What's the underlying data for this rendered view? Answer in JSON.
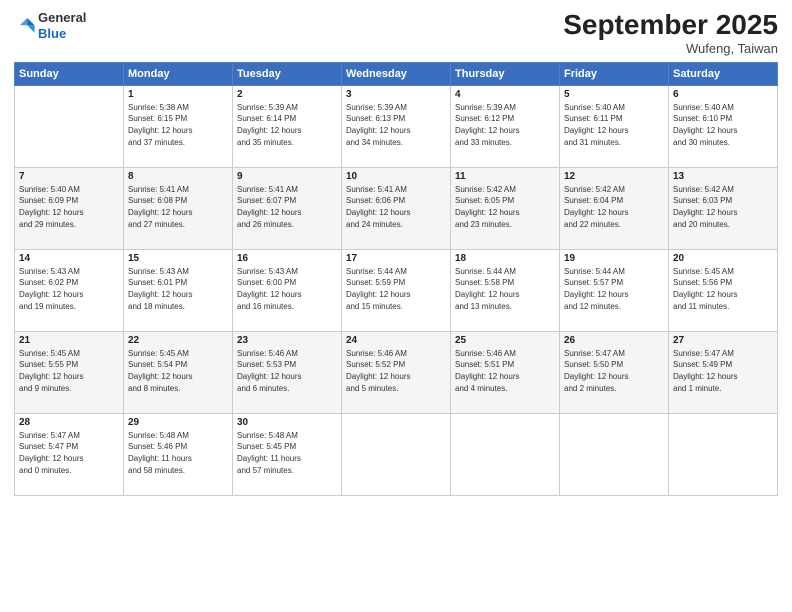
{
  "logo": {
    "general": "General",
    "blue": "Blue"
  },
  "title": "September 2025",
  "subtitle": "Wufeng, Taiwan",
  "days_header": [
    "Sunday",
    "Monday",
    "Tuesday",
    "Wednesday",
    "Thursday",
    "Friday",
    "Saturday"
  ],
  "weeks": [
    [
      {
        "num": "",
        "info": ""
      },
      {
        "num": "1",
        "info": "Sunrise: 5:38 AM\nSunset: 6:15 PM\nDaylight: 12 hours\nand 37 minutes."
      },
      {
        "num": "2",
        "info": "Sunrise: 5:39 AM\nSunset: 6:14 PM\nDaylight: 12 hours\nand 35 minutes."
      },
      {
        "num": "3",
        "info": "Sunrise: 5:39 AM\nSunset: 6:13 PM\nDaylight: 12 hours\nand 34 minutes."
      },
      {
        "num": "4",
        "info": "Sunrise: 5:39 AM\nSunset: 6:12 PM\nDaylight: 12 hours\nand 33 minutes."
      },
      {
        "num": "5",
        "info": "Sunrise: 5:40 AM\nSunset: 6:11 PM\nDaylight: 12 hours\nand 31 minutes."
      },
      {
        "num": "6",
        "info": "Sunrise: 5:40 AM\nSunset: 6:10 PM\nDaylight: 12 hours\nand 30 minutes."
      }
    ],
    [
      {
        "num": "7",
        "info": "Sunrise: 5:40 AM\nSunset: 6:09 PM\nDaylight: 12 hours\nand 29 minutes."
      },
      {
        "num": "8",
        "info": "Sunrise: 5:41 AM\nSunset: 6:08 PM\nDaylight: 12 hours\nand 27 minutes."
      },
      {
        "num": "9",
        "info": "Sunrise: 5:41 AM\nSunset: 6:07 PM\nDaylight: 12 hours\nand 26 minutes."
      },
      {
        "num": "10",
        "info": "Sunrise: 5:41 AM\nSunset: 6:06 PM\nDaylight: 12 hours\nand 24 minutes."
      },
      {
        "num": "11",
        "info": "Sunrise: 5:42 AM\nSunset: 6:05 PM\nDaylight: 12 hours\nand 23 minutes."
      },
      {
        "num": "12",
        "info": "Sunrise: 5:42 AM\nSunset: 6:04 PM\nDaylight: 12 hours\nand 22 minutes."
      },
      {
        "num": "13",
        "info": "Sunrise: 5:42 AM\nSunset: 6:03 PM\nDaylight: 12 hours\nand 20 minutes."
      }
    ],
    [
      {
        "num": "14",
        "info": "Sunrise: 5:43 AM\nSunset: 6:02 PM\nDaylight: 12 hours\nand 19 minutes."
      },
      {
        "num": "15",
        "info": "Sunrise: 5:43 AM\nSunset: 6:01 PM\nDaylight: 12 hours\nand 18 minutes."
      },
      {
        "num": "16",
        "info": "Sunrise: 5:43 AM\nSunset: 6:00 PM\nDaylight: 12 hours\nand 16 minutes."
      },
      {
        "num": "17",
        "info": "Sunrise: 5:44 AM\nSunset: 5:59 PM\nDaylight: 12 hours\nand 15 minutes."
      },
      {
        "num": "18",
        "info": "Sunrise: 5:44 AM\nSunset: 5:58 PM\nDaylight: 12 hours\nand 13 minutes."
      },
      {
        "num": "19",
        "info": "Sunrise: 5:44 AM\nSunset: 5:57 PM\nDaylight: 12 hours\nand 12 minutes."
      },
      {
        "num": "20",
        "info": "Sunrise: 5:45 AM\nSunset: 5:56 PM\nDaylight: 12 hours\nand 11 minutes."
      }
    ],
    [
      {
        "num": "21",
        "info": "Sunrise: 5:45 AM\nSunset: 5:55 PM\nDaylight: 12 hours\nand 9 minutes."
      },
      {
        "num": "22",
        "info": "Sunrise: 5:45 AM\nSunset: 5:54 PM\nDaylight: 12 hours\nand 8 minutes."
      },
      {
        "num": "23",
        "info": "Sunrise: 5:46 AM\nSunset: 5:53 PM\nDaylight: 12 hours\nand 6 minutes."
      },
      {
        "num": "24",
        "info": "Sunrise: 5:46 AM\nSunset: 5:52 PM\nDaylight: 12 hours\nand 5 minutes."
      },
      {
        "num": "25",
        "info": "Sunrise: 5:46 AM\nSunset: 5:51 PM\nDaylight: 12 hours\nand 4 minutes."
      },
      {
        "num": "26",
        "info": "Sunrise: 5:47 AM\nSunset: 5:50 PM\nDaylight: 12 hours\nand 2 minutes."
      },
      {
        "num": "27",
        "info": "Sunrise: 5:47 AM\nSunset: 5:49 PM\nDaylight: 12 hours\nand 1 minute."
      }
    ],
    [
      {
        "num": "28",
        "info": "Sunrise: 5:47 AM\nSunset: 5:47 PM\nDaylight: 12 hours\nand 0 minutes."
      },
      {
        "num": "29",
        "info": "Sunrise: 5:48 AM\nSunset: 5:46 PM\nDaylight: 11 hours\nand 58 minutes."
      },
      {
        "num": "30",
        "info": "Sunrise: 5:48 AM\nSunset: 5:45 PM\nDaylight: 11 hours\nand 57 minutes."
      },
      {
        "num": "",
        "info": ""
      },
      {
        "num": "",
        "info": ""
      },
      {
        "num": "",
        "info": ""
      },
      {
        "num": "",
        "info": ""
      }
    ]
  ]
}
